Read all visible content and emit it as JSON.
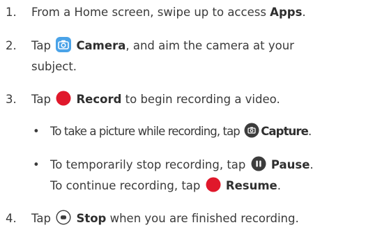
{
  "steps": [
    {
      "number": "1.",
      "pre": "From a Home screen, swipe up to access ",
      "bold": "Apps",
      "post": "."
    },
    {
      "number": "2.",
      "pre": "Tap ",
      "icon": "camera-app-icon",
      "bold": "Camera",
      "post": ", and aim the camera at your",
      "cont": "subject."
    },
    {
      "number": "3.",
      "pre": "Tap ",
      "icon": "record-icon",
      "bold": "Record",
      "post": " to begin recording a video."
    },
    {
      "number": "4.",
      "pre": "Tap ",
      "icon": "stop-icon",
      "bold": "Stop",
      "post": " when you are finished recording."
    }
  ],
  "sub_bullets": [
    {
      "pre": "To take a picture while recording, tap ",
      "icon": "capture-icon",
      "bold": "Capture",
      "post": "."
    },
    {
      "pre": "To temporarily stop recording, tap ",
      "icon": "pause-icon",
      "bold": "Pause",
      "post": ".",
      "line2_pre": "To continue recording, tap ",
      "line2_icon": "resume-icon",
      "line2_bold": "Resume",
      "line2_post": "."
    }
  ],
  "colors": {
    "text": "#3a3a3a",
    "record_red": "#e0182b",
    "camera_blue": "#4aa3e8",
    "icon_dark": "#3c3c3c"
  }
}
